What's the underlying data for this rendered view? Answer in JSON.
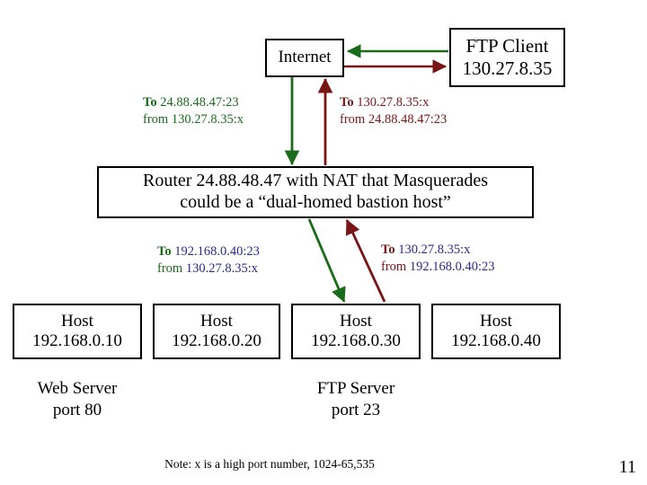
{
  "colors": {
    "green": "#1a6b1a",
    "dark_red": "#7a1515",
    "navy": "#2a2a8c",
    "black": "#000000",
    "background": "#ffffff"
  },
  "nodes": {
    "internet": {
      "label": "Internet"
    },
    "ftp_client": {
      "line1": "FTP Client",
      "line2": "130.27.8.35"
    },
    "router": {
      "line1": "Router 24.88.48.47 with NAT that Masquerades",
      "line2": "could be a “dual-homed bastion host”"
    },
    "hosts": [
      {
        "title": "Host",
        "ip": "192.168.0.10"
      },
      {
        "title": "Host",
        "ip": "192.168.0.20"
      },
      {
        "title": "Host",
        "ip": "192.168.0.30"
      },
      {
        "title": "Host",
        "ip": "192.168.0.40"
      }
    ]
  },
  "packet_labels": {
    "outbound_top": {
      "to_word": "To",
      "to_addr": "24.88.48.47:23",
      "from_word": "from",
      "from_addr": "130.27.8.35:x",
      "color": "#1a6b1a",
      "addr_color": "#1a6b1a"
    },
    "inbound_top": {
      "to_word": "To",
      "to_addr": "130.27.8.35:x",
      "from_word": "from",
      "from_addr": "24.88.48.47:23",
      "color": "#7a1515",
      "addr_color": "#7a1515"
    },
    "outbound_bottom": {
      "to_word": "To",
      "to_addr": "192.168.0.40:23",
      "from_word": "from",
      "from_addr": "130.27.8.35:x",
      "color": "#1a6b1a",
      "addr_color": "#2a2a8c"
    },
    "inbound_bottom": {
      "to_word": "To",
      "to_addr": "130.27.8.35:x",
      "from_word": "from",
      "from_addr": "192.168.0.40:23",
      "color": "#7a1515",
      "addr_color": "#2a2a8c"
    }
  },
  "server_labels": {
    "web": {
      "line1": "Web Server",
      "line2": "port 80"
    },
    "ftp": {
      "line1": "FTP Server",
      "line2": "port 23"
    }
  },
  "footer": {
    "note": "Note: x is a high port number, 1024-65,535",
    "page_number": "11"
  }
}
